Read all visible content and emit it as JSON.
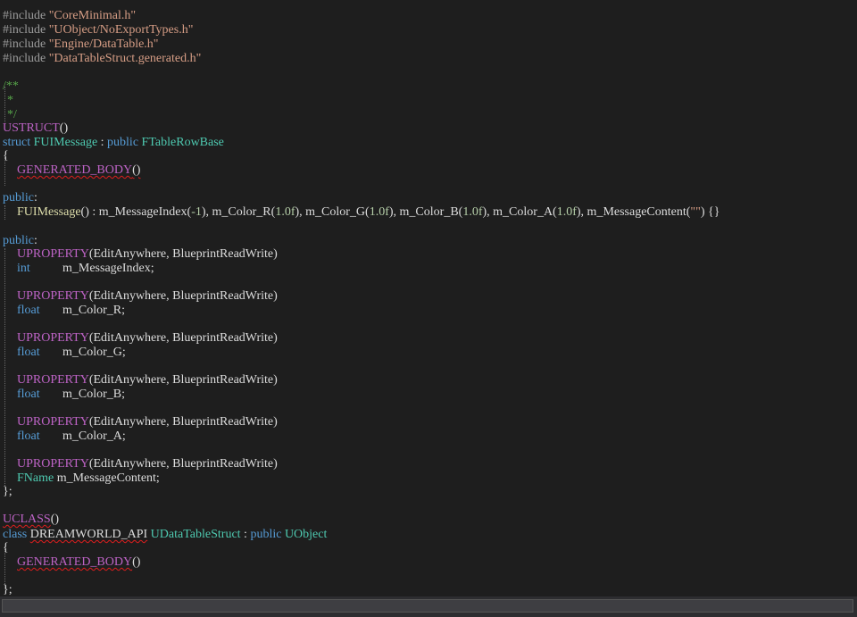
{
  "code": {
    "inc": "#include",
    "inc1": "\"CoreMinimal.h\"",
    "inc2": "\"UObject/NoExportTypes.h\"",
    "inc3": "\"Engine/DataTable.h\"",
    "inc4": "\"DataTableStruct.generated.h\"",
    "cm_open": "/**",
    "cm_star": "*",
    "cm_close": "*/",
    "ustruct": "USTRUCT",
    "parens": "()",
    "struct_kw": "struct",
    "fuimessage": "FUIMessage",
    "colon": " : ",
    "public_kw": "public",
    "ftablerowbase": "FTableRowBase",
    "brace_open": "{",
    "generated_body": "GENERATED_BODY",
    "public_label": "public",
    "colon_only": ":",
    "ctor_name": "FUIMessage",
    "ctor_sep": "() : m_MessageIndex(",
    "ctor_v1": "-1",
    "ctor_mid1": "), m_Color_R(",
    "ctor_v2": "1.0f",
    "ctor_mid2": "), m_Color_G(",
    "ctor_v3": "1.0f",
    "ctor_mid3": "), m_Color_B(",
    "ctor_v4": "1.0f",
    "ctor_mid4": "), m_Color_A(",
    "ctor_v5": "1.0f",
    "ctor_mid5": "), m_MessageContent(",
    "ctor_str": "\"\"",
    "ctor_end": ") {}",
    "uproperty": "UPROPERTY",
    "uprop_args": "(EditAnywhere, BlueprintReadWrite)",
    "int_kw": "int",
    "float_kw": "float",
    "fname": "FName",
    "var_index": "m_MessageIndex;",
    "var_r": "m_Color_R;",
    "var_g": "m_Color_G;",
    "var_b": "m_Color_B;",
    "var_a": "m_Color_A;",
    "var_content": "m_MessageContent;",
    "brace_close_semi": "};",
    "uclass": "UCLASS",
    "class_kw": "class",
    "api": "DREAMWORLD_API",
    "udatatablestruct": "UDataTableStruct",
    "uobject": "UObject",
    "spacer": " ",
    "tabpad": "    "
  },
  "colors": {
    "background": "#1e1e1e",
    "keyword": "#569cd6",
    "type": "#4ec9b0",
    "macro": "#bd63c5",
    "string": "#d69d85",
    "comment": "#57a64a",
    "number": "#b5cea8"
  }
}
